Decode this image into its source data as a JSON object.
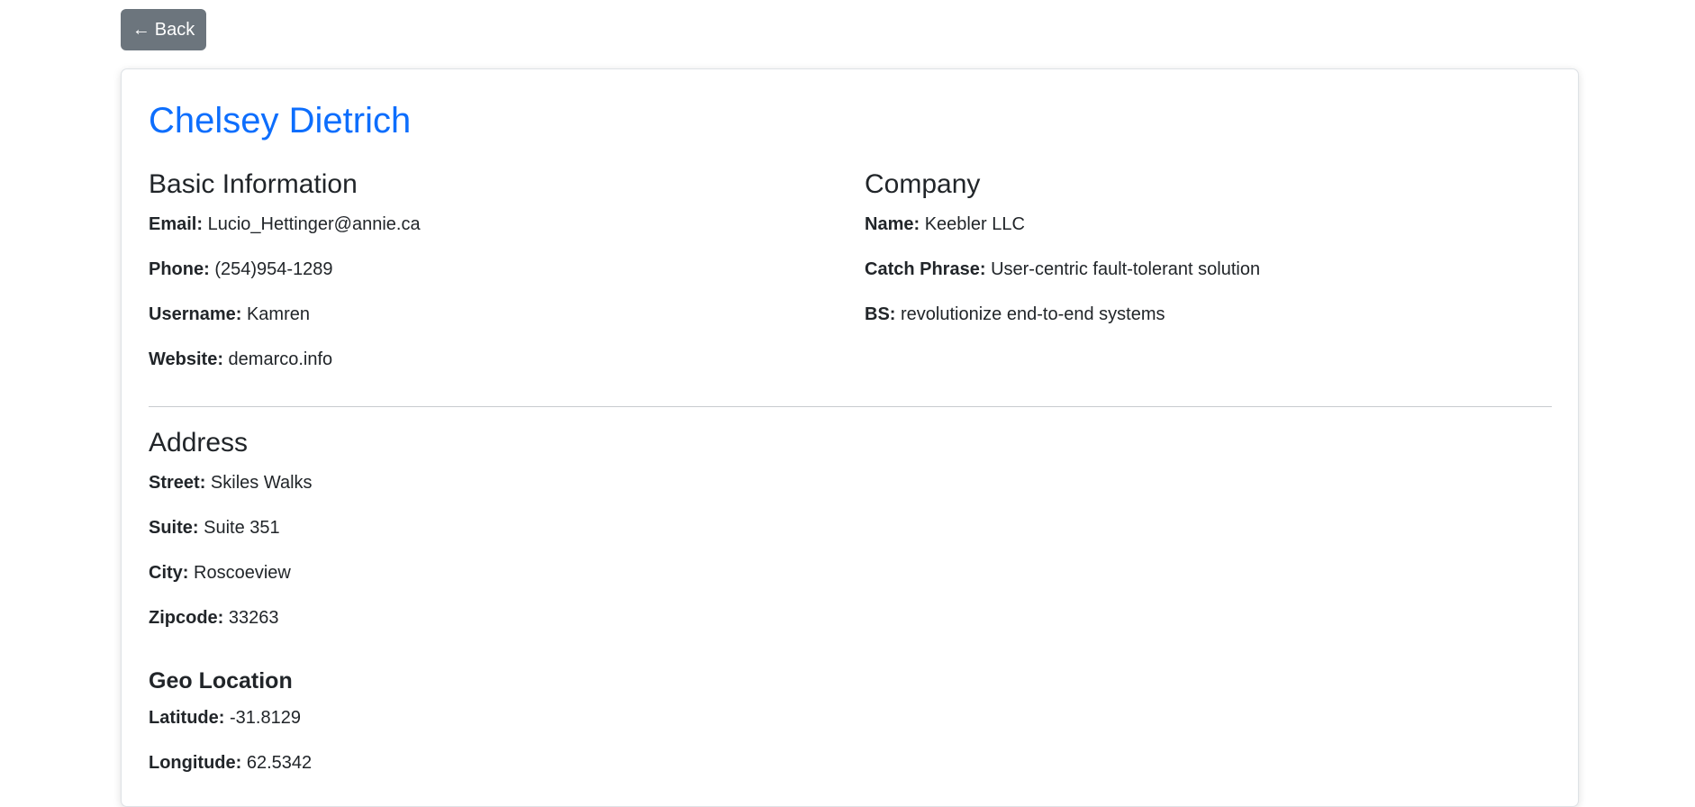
{
  "back_button": {
    "arrow": "←",
    "label": "Back"
  },
  "user": {
    "name": "Chelsey Dietrich"
  },
  "basic_info": {
    "title": "Basic Information",
    "fields": [
      {
        "label": "Email:",
        "value": "Lucio_Hettinger@annie.ca"
      },
      {
        "label": "Phone:",
        "value": "(254)954-1289"
      },
      {
        "label": "Username:",
        "value": "Kamren"
      },
      {
        "label": "Website:",
        "value": "demarco.info"
      }
    ]
  },
  "company": {
    "title": "Company",
    "fields": [
      {
        "label": "Name:",
        "value": "Keebler LLC"
      },
      {
        "label": "Catch Phrase:",
        "value": "User-centric fault-tolerant solution"
      },
      {
        "label": "BS:",
        "value": "revolutionize end-to-end systems"
      }
    ]
  },
  "address": {
    "title": "Address",
    "fields": [
      {
        "label": "Street:",
        "value": "Skiles Walks"
      },
      {
        "label": "Suite:",
        "value": "Suite 351"
      },
      {
        "label": "City:",
        "value": "Roscoeview"
      },
      {
        "label": "Zipcode:",
        "value": "33263"
      }
    ]
  },
  "geo": {
    "title": "Geo Location",
    "fields": [
      {
        "label": "Latitude:",
        "value": "-31.8129"
      },
      {
        "label": "Longitude:",
        "value": "62.5342"
      }
    ]
  },
  "colors": {
    "accent": "#0d6efd",
    "back_button_bg": "#6c757d",
    "text": "#212529"
  }
}
